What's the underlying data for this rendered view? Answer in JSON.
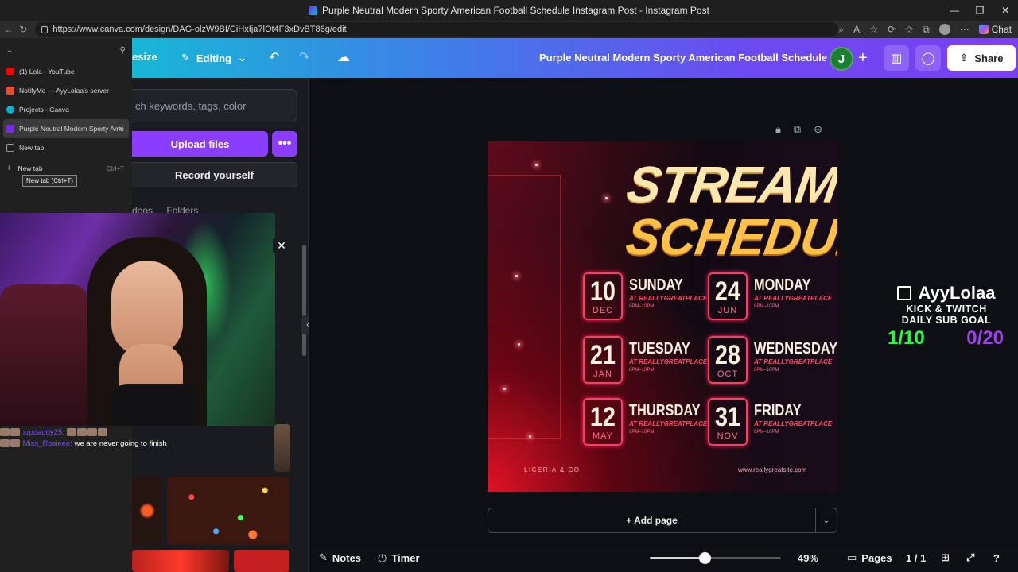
{
  "browser": {
    "window_title": "Purple Neutral Modern Sporty American Football Schedule Instagram Post - Instagram Post",
    "url": "https://www.canva.com/design/DAG-olzW9BI/CiHxIja7lOt4F3xDvBT86g/edit",
    "chat_label": "Chat"
  },
  "tabs": {
    "items": [
      {
        "label": "(1) Lola - YouTube",
        "color": "#ff0000"
      },
      {
        "label": "NotifyMe — AyyLolaa's server",
        "color": "#f04a2a"
      },
      {
        "label": "Projects - Canva",
        "color": "#00b4d8"
      },
      {
        "label": "Purple Neutral Modern Sporty Ame",
        "color": "#7d2ae8"
      },
      {
        "label": "New tab",
        "color": "#444444"
      }
    ],
    "new_tab_label": "New tab",
    "new_tab_shortcut": "Ctrl+T",
    "tooltip": "New tab (Ctrl+T)"
  },
  "header": {
    "resize_label": "esize",
    "editing_label": "Editing",
    "doc_title": "Purple Neutral Modern Sporty American Football Schedule ...",
    "avatar_initial": "J",
    "share_label": "Share"
  },
  "side_panel": {
    "search_placeholder": "ch keywords, tags, color",
    "upload_label": "Upload files",
    "record_label": "Record yourself",
    "tabs": [
      "deos",
      "Folders"
    ]
  },
  "chat": {
    "lines": [
      {
        "user": "xrpdaddy25:",
        "msg": ""
      },
      {
        "user": "Miss_Rosieee:",
        "msg": "we are never going to finish"
      }
    ]
  },
  "design": {
    "title_line1": "STREAM",
    "title_line2": "SCHEDULE",
    "days": [
      {
        "num": "10",
        "month": "DEC",
        "name": "SUNDAY",
        "place": "AT REALLYGREATPLACE",
        "time": "8PM–10PM"
      },
      {
        "num": "24",
        "month": "JUN",
        "name": "MONDAY",
        "place": "AT REALLYGREATPLACE",
        "time": "8PM–10PM"
      },
      {
        "num": "21",
        "month": "JAN",
        "name": "TUESDAY",
        "place": "AT REALLYGREATPLACE",
        "time": "8PM–10PM"
      },
      {
        "num": "28",
        "month": "OCT",
        "name": "WEDNESDAY",
        "place": "AT REALLYGREATPLACE",
        "time": "8PM–10PM"
      },
      {
        "num": "12",
        "month": "MAY",
        "name": "THURSDAY",
        "place": "AT REALLYGREATPLACE",
        "time": "8PM–10PM"
      },
      {
        "num": "31",
        "month": "NOV",
        "name": "FRIDAY",
        "place": "AT REALLYGREATPLACE",
        "time": "8PM–10PM"
      }
    ],
    "footer_left": "LICERIA & CO.",
    "footer_right": "www.reallygreatsite.com"
  },
  "add_page_label": "+ Add page",
  "overlay": {
    "name": "AyyLolaa",
    "line1": "KICK & TWITCH",
    "line2": "DAILY SUB GOAL",
    "count_left": "1/10",
    "count_right": "0/20"
  },
  "bottom": {
    "notes_label": "Notes",
    "timer_label": "Timer",
    "zoom": "49%",
    "zoom_fraction": 0.42,
    "pages_label": "Pages",
    "page_count": "1 / 1"
  },
  "colors": {
    "canva_purple": "#8b3dff",
    "goal_green": "#22ff44",
    "goal_purple": "#a23ff2"
  }
}
